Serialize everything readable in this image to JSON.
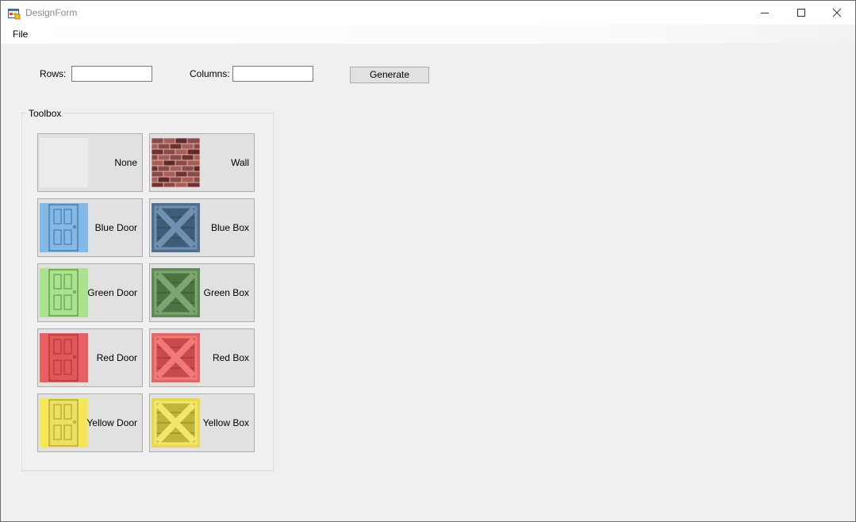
{
  "window": {
    "title": "DesignForm",
    "app_icon": "winforms-app-icon",
    "controls": [
      "minimize-icon",
      "maximize-icon",
      "close-icon"
    ]
  },
  "menu": {
    "file": "File"
  },
  "form": {
    "rows_label": "Rows:",
    "rows_value": "",
    "columns_label": "Columns:",
    "columns_value": "",
    "generate_label": "Generate"
  },
  "toolbox": {
    "title": "Toolbox",
    "items": [
      {
        "label": "None",
        "icon": "empty-tile-icon",
        "color": "#ececec"
      },
      {
        "label": "Wall",
        "icon": "brick-wall-icon",
        "color": "#8c4a45"
      },
      {
        "label": "Blue Door",
        "icon": "blue-door-icon",
        "color": "#84b8e6"
      },
      {
        "label": "Blue Box",
        "icon": "blue-crate-icon",
        "color": "#50708e"
      },
      {
        "label": "Green Door",
        "icon": "green-door-icon",
        "color": "#a9e38d"
      },
      {
        "label": "Green Box",
        "icon": "green-crate-icon",
        "color": "#5f8c54"
      },
      {
        "label": "Red Door",
        "icon": "red-door-icon",
        "color": "#ea6060"
      },
      {
        "label": "Red Box",
        "icon": "red-crate-icon",
        "color": "#e86464"
      },
      {
        "label": "Yellow Door",
        "icon": "yellow-door-icon",
        "color": "#f0e060"
      },
      {
        "label": "Yellow Box",
        "icon": "yellow-crate-icon",
        "color": "#e8d84a"
      }
    ]
  }
}
